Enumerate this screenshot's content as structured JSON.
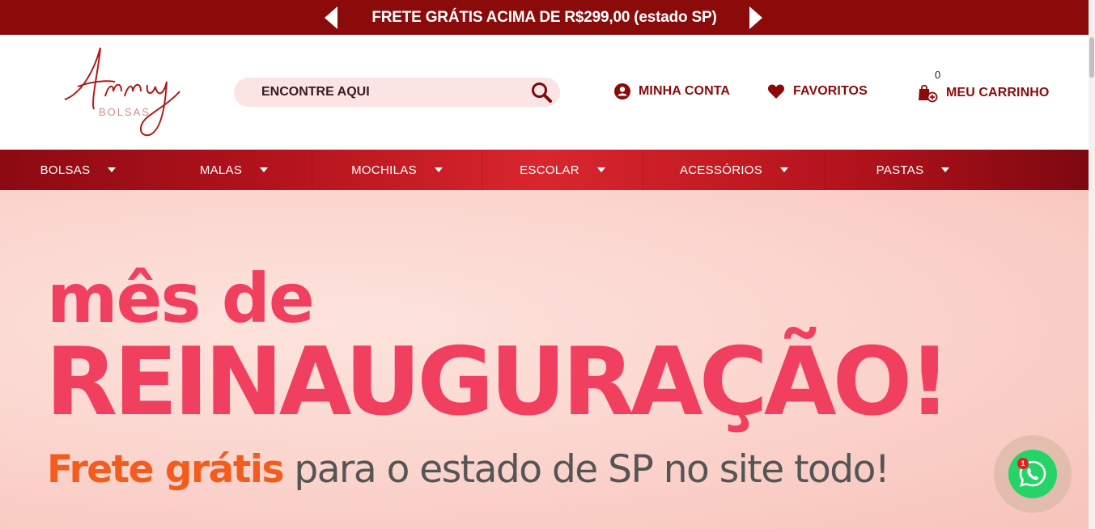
{
  "promo": {
    "text": "FRETE GRÁTIS ACIMA DE R$299,00 (estado SP)"
  },
  "brand": {
    "script": "Anny",
    "sub": "BOLSAS"
  },
  "search": {
    "placeholder": "ENCONTRE AQUI"
  },
  "header": {
    "account_label": "MINHA CONTA",
    "favorites_label": "FAVORITOS",
    "cart_label": "MEU CARRINHO",
    "cart_count": "0"
  },
  "nav": {
    "items": [
      {
        "label": "BOLSAS"
      },
      {
        "label": "MALAS"
      },
      {
        "label": "MOCHILAS"
      },
      {
        "label": "ESCOLAR"
      },
      {
        "label": "ACESSÓRIOS"
      },
      {
        "label": "PASTAS"
      }
    ]
  },
  "hero": {
    "line1": "mês de",
    "line2": "REINAUGURAÇÃO!",
    "line3_accent": "Frete grátis",
    "line3_rest": " para o estado de SP no site todo!"
  },
  "whatsapp": {
    "badge": "1"
  },
  "colors": {
    "brand_dark": "#8b0a0a",
    "hero_pink": "#f13f5f",
    "accent_orange": "#f25c1f",
    "whatsapp_green": "#25d366"
  }
}
